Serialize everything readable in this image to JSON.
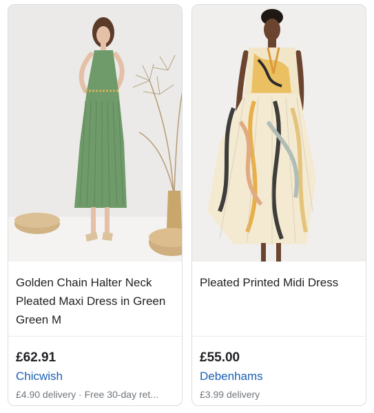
{
  "products": [
    {
      "title": "Golden Chain Halter Neck Pleated Maxi Dress in Green Green M",
      "price": "£62.91",
      "seller": "Chicwish",
      "delivery": "£4.90 delivery · Free 30-day ret..."
    },
    {
      "title": "Pleated Printed Midi Dress",
      "price": "£55.00",
      "seller": "Debenhams",
      "delivery": "£3.99 delivery"
    }
  ],
  "colors": {
    "seller_link": "#1a5fb4",
    "price_text": "#202124",
    "secondary_text": "#70757a",
    "card_border": "#dadce0"
  }
}
